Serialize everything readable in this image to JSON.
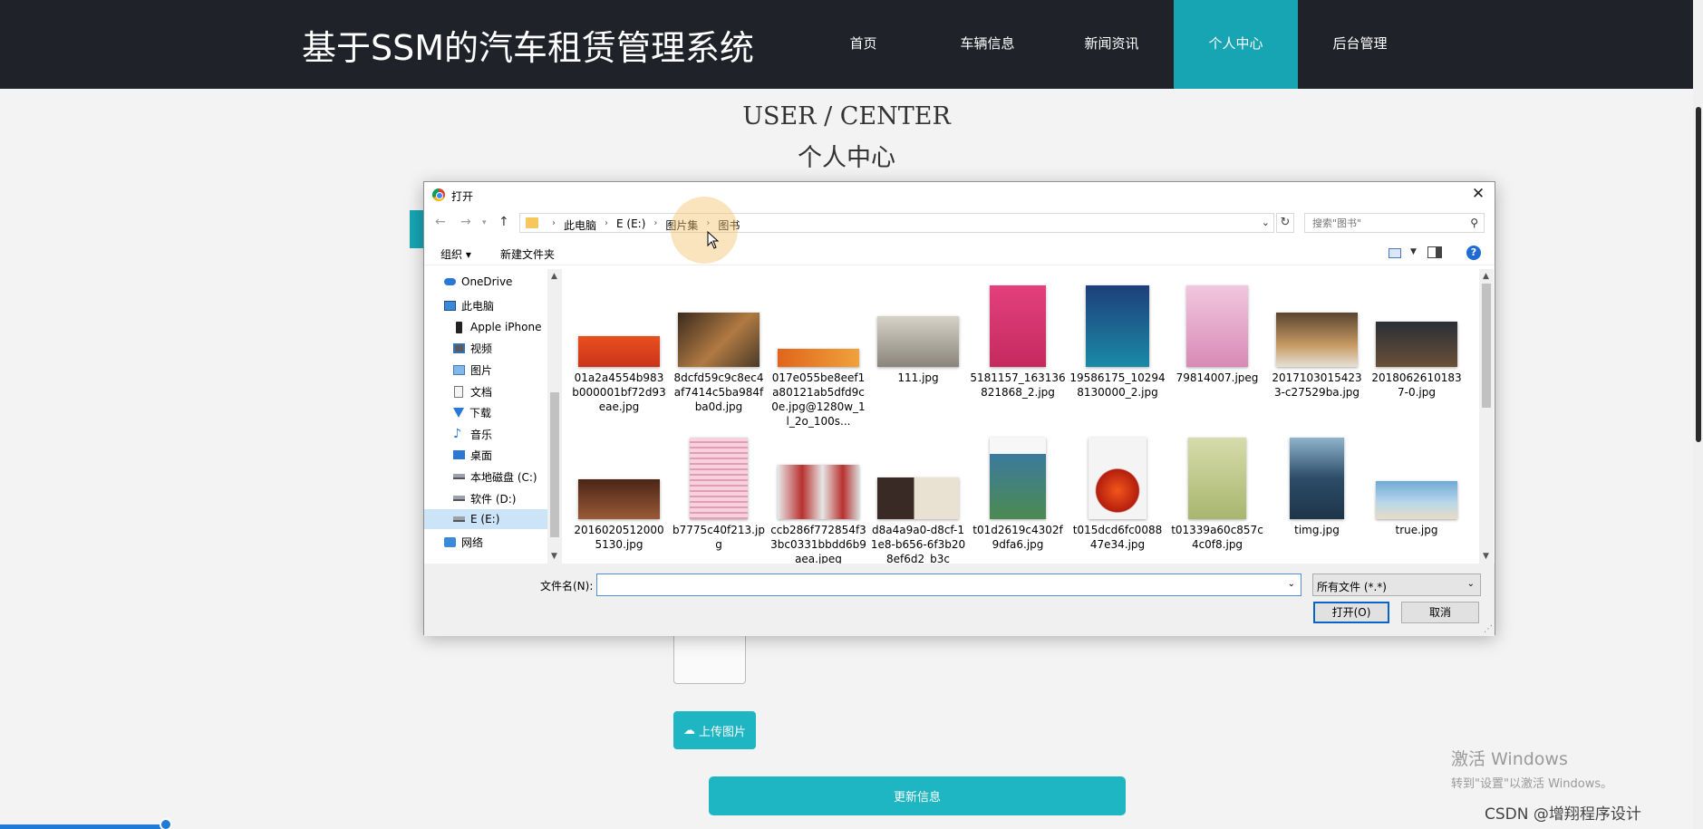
{
  "header": {
    "site_title": "基于SSM的汽车租赁管理系统",
    "nav": [
      {
        "label": "首页",
        "active": false
      },
      {
        "label": "车辆信息",
        "active": false
      },
      {
        "label": "新闻资讯",
        "active": false
      },
      {
        "label": "个人中心",
        "active": true
      },
      {
        "label": "后台管理",
        "active": false
      }
    ]
  },
  "page": {
    "title_en": "USER / CENTER",
    "title_cn": "个人中心",
    "upload_label": "上传图片",
    "update_label": "更新信息"
  },
  "dialog": {
    "title": "打开",
    "close": "✕",
    "breadcrumb": [
      "此电脑",
      "E (E:)",
      "图片集",
      "图书"
    ],
    "search_placeholder": "搜索\"图书\"",
    "toolbar": {
      "organize": "组织 ▾",
      "new_folder": "新建文件夹",
      "help": "?"
    },
    "sidebar": [
      {
        "label": "OneDrive",
        "icon": "onedrive-icon",
        "selected": false
      },
      {
        "label": "此电脑",
        "icon": "computer-icon",
        "selected": false
      },
      {
        "label": "Apple iPhone",
        "icon": "phone-icon",
        "selected": false
      },
      {
        "label": "视频",
        "icon": "video-icon",
        "selected": false
      },
      {
        "label": "图片",
        "icon": "picture-icon",
        "selected": false
      },
      {
        "label": "文档",
        "icon": "document-icon",
        "selected": false
      },
      {
        "label": "下载",
        "icon": "download-icon",
        "selected": false
      },
      {
        "label": "音乐",
        "icon": "music-icon",
        "selected": false
      },
      {
        "label": "桌面",
        "icon": "desktop-icon",
        "selected": false
      },
      {
        "label": "本地磁盘 (C:)",
        "icon": "drive-icon",
        "selected": false
      },
      {
        "label": "软件 (D:)",
        "icon": "drive-icon",
        "selected": false
      },
      {
        "label": "E (E:)",
        "icon": "drive-icon",
        "selected": true
      },
      {
        "label": "网络",
        "icon": "network-icon",
        "selected": false
      }
    ],
    "files": [
      {
        "name": "01a2a4554b983b000001bf72d93eae.jpg",
        "color": "#d8441e"
      },
      {
        "name": "8dcfd59c9c8ec4af7414c5ba984fba0d.jpg",
        "color": "#6b4a2e"
      },
      {
        "name": "017e055be8eef1a80121ab5dfd9c0e.jpg@1280w_1l_2o_100s...",
        "color": "#e0651c"
      },
      {
        "name": "111.jpg",
        "color": "#a8a39a"
      },
      {
        "name": "5181157_163136821868_2.jpg",
        "color": "#d6336e"
      },
      {
        "name": "19586175_102948130000_2.jpg",
        "color": "#1a5f8c"
      },
      {
        "name": "79814007.jpeg",
        "color": "#e0a5c8"
      },
      {
        "name": "20171030154233-c27529ba.jpg",
        "color": "#8a6a48"
      },
      {
        "name": "20180626101837-0.jpg",
        "color": "#3a3e46"
      },
      {
        "name": "20160205120005130.jpg",
        "color": "#6a3a22"
      },
      {
        "name": "b7775c40f213.jpg",
        "color": "#e9b4c6"
      },
      {
        "name": "ccb286f772854f33bc0331bbdd6b9aea.jpeg",
        "color": "#b8312f"
      },
      {
        "name": "d8a4a9a0-d8cf-11e8-b656-6f3b208ef6d2_b3c",
        "color": "#c9bfae"
      },
      {
        "name": "t01d2619c4302f9dfa6.jpg",
        "color": "#3b7a9e"
      },
      {
        "name": "t015dcd6fc008847e34.jpg",
        "color": "#c42a14"
      },
      {
        "name": "t01339a60c857c4c0f8.jpg",
        "color": "#b9c48a"
      },
      {
        "name": "timg.jpg",
        "color": "#2c4c68"
      },
      {
        "name": "true.jpg",
        "color": "#7fb4d6"
      }
    ],
    "filename_label": "文件名(N):",
    "filename_value": "",
    "filetype": "所有文件 (*.*)",
    "open_button": "打开(O)",
    "cancel_button": "取消"
  },
  "watermark": {
    "line1": "激活 Windows",
    "line2": "转到\"设置\"以激活 Windows。",
    "csdn": "CSDN @增翔程序设计"
  }
}
